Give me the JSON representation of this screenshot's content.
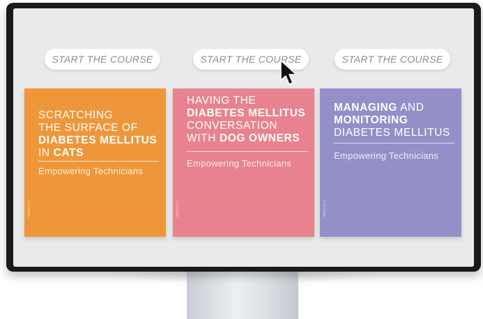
{
  "buttons": [
    {
      "label": "START THE COURSE"
    },
    {
      "label": "START THE COURSE"
    },
    {
      "label": "START THE COURSE"
    }
  ],
  "cards": [
    {
      "color": "#ee973a",
      "title_lines": [
        [
          {
            "text": "SCRATCHING",
            "bold": false
          }
        ],
        [
          {
            "text": "THE SURFACE OF",
            "bold": false
          }
        ],
        [
          {
            "text": "DIABETES MELLITUS",
            "bold": true
          }
        ],
        [
          {
            "text": "IN ",
            "bold": false
          },
          {
            "text": "CATS",
            "bold": true
          }
        ]
      ],
      "subtitle": "Empowering Technicians",
      "module_label": "MODULE 1"
    },
    {
      "color": "#e8828f",
      "title_lines": [
        [
          {
            "text": "HAVING THE",
            "bold": false
          }
        ],
        [
          {
            "text": "DIABETES MELLITUS",
            "bold": true
          }
        ],
        [
          {
            "text": "CONVERSATION",
            "bold": false
          }
        ],
        [
          {
            "text": "WITH ",
            "bold": false
          },
          {
            "text": "DOG OWNERS",
            "bold": true
          }
        ]
      ],
      "subtitle": "Empowering Technicians",
      "module_label": "MODULE 2"
    },
    {
      "color": "#948fc8",
      "title_lines": [
        [
          {
            "text": "MANAGING",
            "bold": true
          },
          {
            "text": " AND",
            "bold": false
          }
        ],
        [
          {
            "text": "MONITORING",
            "bold": true
          }
        ],
        [
          {
            "text": "DIABETES MELLITUS",
            "bold": false
          }
        ]
      ],
      "subtitle": "Empowering Technicians",
      "module_label": "MODULE 3"
    }
  ],
  "icons": {
    "cursor": "arrow-cursor-icon"
  }
}
